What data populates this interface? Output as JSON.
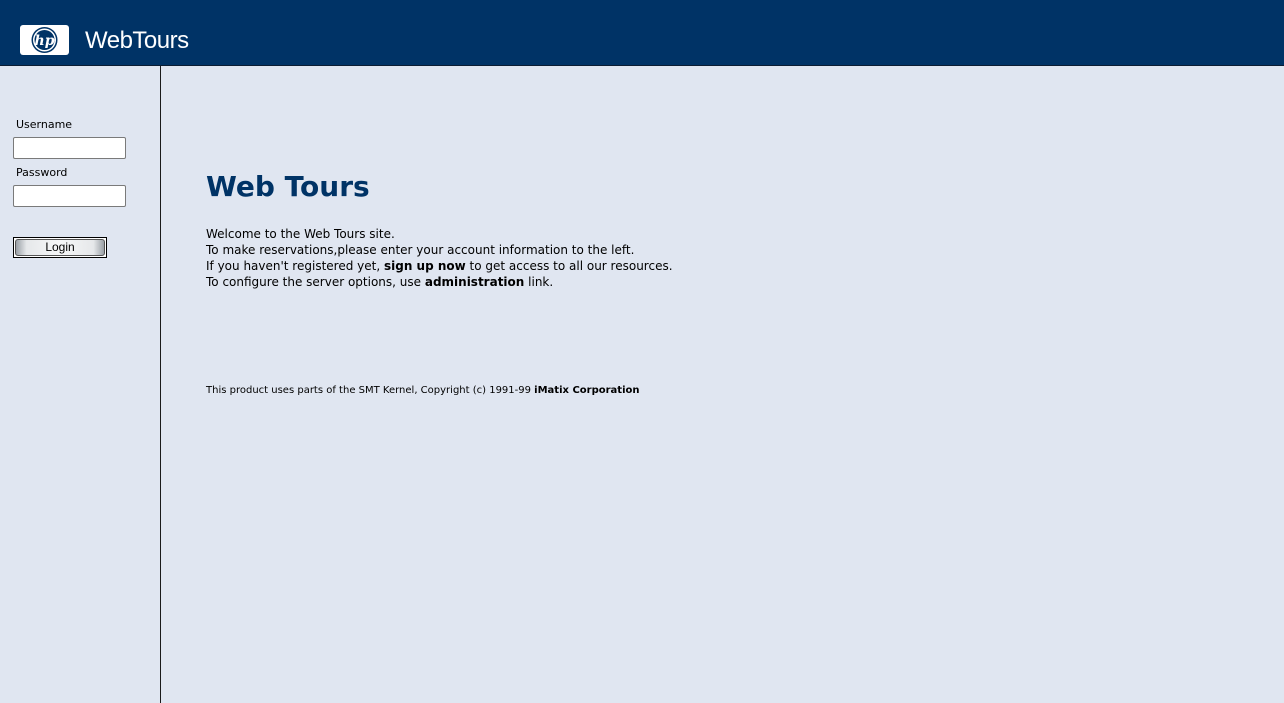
{
  "header": {
    "logo_text": "hp",
    "brand": "WebTours",
    "background": "#003366"
  },
  "sidebar": {
    "username_label": "Username",
    "username_value": "",
    "password_label": "Password",
    "password_value": "",
    "login_label": "Login"
  },
  "main": {
    "title": "Web Tours",
    "line1": "Welcome to the Web Tours site.",
    "line2": "To make reservations,please enter your account information to the left.",
    "line3_before": "If you haven't registered yet, ",
    "line3_link": "sign up now",
    "line3_after": " to get access to all our resources.",
    "line4_before": "To configure the server options, use ",
    "line4_link": "administration",
    "line4_after": " link.",
    "footer_text": "This product uses parts of the SMT Kernel, Copyright (c) 1991-99 ",
    "footer_bold": "iMatix Corporation"
  },
  "colors": {
    "page_bg": "#e0e6f1",
    "title": "#003366"
  }
}
